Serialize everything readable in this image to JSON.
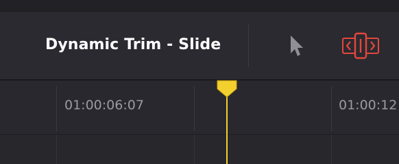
{
  "toolbar": {
    "mode_label": "Dynamic Trim - Slide",
    "pointer_icon": "pointer-arrow-icon",
    "trim_icon": "slide-trim-icon",
    "trim_active_color": "#e5473c"
  },
  "ruler": {
    "timecodes": [
      "01:00:06:07",
      "01:00:12"
    ]
  },
  "playhead": {
    "color": "#f4d02f"
  }
}
